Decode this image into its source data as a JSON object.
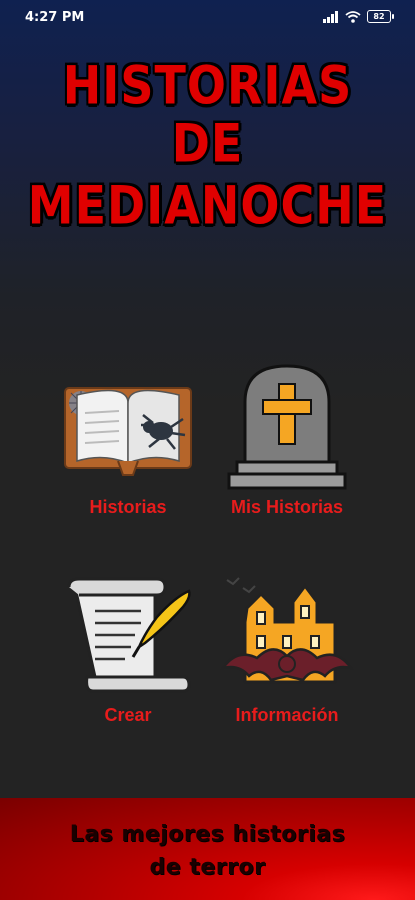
{
  "status_bar": {
    "time": "4:27 PM",
    "battery": "82",
    "icons": [
      "signal-icon",
      "wifi-icon",
      "battery-icon"
    ]
  },
  "header": {
    "title_line1": "HISTORIAS",
    "title_line2": "DE MEDIANOCHE"
  },
  "menu": {
    "items": [
      {
        "label": "Historias",
        "icon": "open-book-spider-icon"
      },
      {
        "label": "Mis Historias",
        "icon": "tombstone-cross-icon"
      },
      {
        "label": "Crear",
        "icon": "scroll-quill-icon"
      },
      {
        "label": "Información",
        "icon": "haunted-house-bat-icon"
      }
    ]
  },
  "footer": {
    "line1": "Las mejores historias",
    "line2": "de terror"
  },
  "colors": {
    "title": "#e00000",
    "label": "#e81c1c",
    "footer_bg": "#c00000",
    "background": "#232323"
  }
}
